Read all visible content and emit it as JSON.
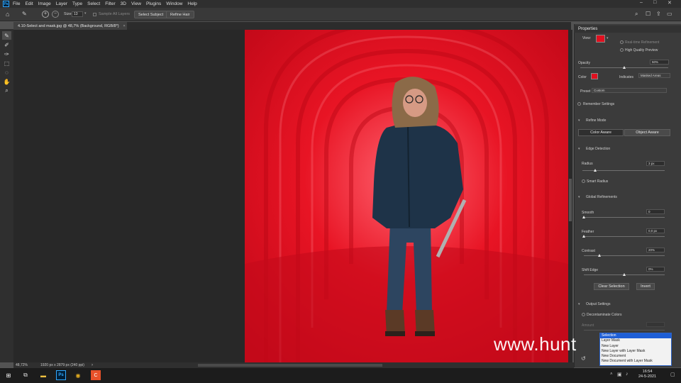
{
  "menubar": {
    "app_icon": "Ps",
    "items": [
      "File",
      "Edit",
      "Image",
      "Layer",
      "Type",
      "Select",
      "Filter",
      "3D",
      "View",
      "Plugins",
      "Window",
      "Help"
    ],
    "window_controls": [
      "–",
      "□",
      "✕"
    ]
  },
  "options": {
    "size_label": "Size:",
    "size_value": "13",
    "sample_all_layers": "Sample All Layers",
    "select_subject": "Select Subject",
    "refine_hair": "Refine Hair"
  },
  "document": {
    "tab_title": "4.10-Select and mask.jpg @ 48,7% (Background, RGB/8*)",
    "tab_close": "×",
    "zoom": "48,72%",
    "dimensions": "1920 px x 2879 px (240 ppi)"
  },
  "properties": {
    "title": "Properties",
    "view_label": "View:",
    "real_time_refinement": "Real-time Refinement",
    "high_quality_preview": "High Quality Preview",
    "opacity_label": "Opacity",
    "opacity_value": "50%",
    "opacity_fraction": 0.5,
    "color_label": "Color",
    "overlay_color": "#e0101f",
    "indicates_label": "Indicates",
    "indicates_value": "Masked Areas",
    "preset_label": "Preset",
    "preset_value": "Custom",
    "remember_settings": "Remember Settings",
    "refine_mode_title": "Refine Mode",
    "color_aware": "Color Aware",
    "object_aware": "Object Aware",
    "edge_detection_title": "Edge Detection",
    "radius_label": "Radius",
    "radius_value": "3 px",
    "radius_fraction": 0.16,
    "smart_radius": "Smart Radius",
    "global_refinements_title": "Global Refinements",
    "smooth_label": "Smooth",
    "smooth_value": "0",
    "smooth_fraction": 0,
    "feather_label": "Feather",
    "feather_value": "0,0 px",
    "feather_fraction": 0,
    "contrast_label": "Contrast",
    "contrast_value": "20%",
    "contrast_fraction": 0.2,
    "shift_edge_label": "Shift Edge",
    "shift_edge_value": "0%",
    "shift_edge_fraction": 0.5,
    "clear_selection": "Clear Selection",
    "invert": "Invert",
    "output_settings_title": "Output Settings",
    "decontaminate_colors": "Decontaminate Colors",
    "amount_label": "Amount",
    "output_options": [
      "Selection",
      "Layer Mask",
      "New Layer",
      "New Layer with Layer Mask",
      "New Document",
      "New Document with Layer Mask"
    ],
    "output_selected": "Selection"
  },
  "watermark": "www.hunt",
  "taskbar": {
    "time": "16:54",
    "date": "24-5-2021"
  }
}
